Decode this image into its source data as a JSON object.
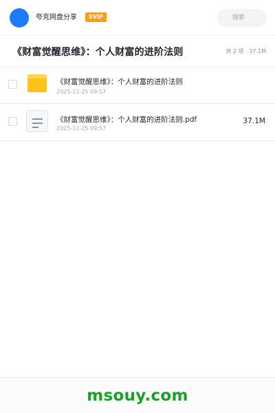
{
  "header": {
    "app_name": "夸克网盘分享",
    "badge": "SVIP",
    "search_placeholder": "搜索",
    "accent_color": "#1e7bff",
    "badge_color": "#ff9f1a"
  },
  "folder": {
    "title": "《财富觉醒思维》：个人财富的进阶法则",
    "summary": "共 2 项 · 37.1M"
  },
  "files": [
    {
      "name": "《财富觉醒思维》：个人财富的进阶法则",
      "date": "2025-11-25 09:57",
      "size": "",
      "icon": "folder-icon"
    },
    {
      "name": "《财富觉醒思维》：个人财富的进阶法则.pdf",
      "date": "2025-11-25 09:57",
      "size": "37.1M",
      "icon": "document-icon"
    }
  ],
  "watermark": {
    "text": "msouy.com",
    "color": "#1a9e2c"
  }
}
